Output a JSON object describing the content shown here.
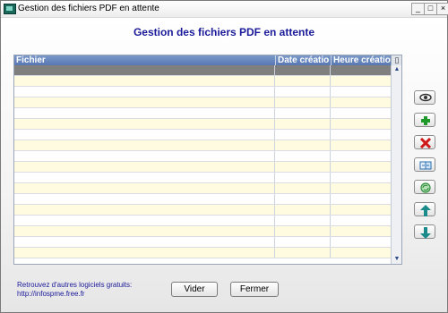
{
  "window": {
    "title": "Gestion des fichiers PDF en attente",
    "controls": [
      "_",
      "□",
      "×"
    ]
  },
  "heading": "Gestion des fichiers PDF en attente",
  "table": {
    "columns": [
      "Fichier",
      "Date création",
      "Heure création"
    ],
    "rows": 18,
    "selected_row": 0
  },
  "side_buttons": [
    {
      "name": "view-icon",
      "color": "#333333"
    },
    {
      "name": "add-icon",
      "color": "#1f9a2a"
    },
    {
      "name": "delete-icon",
      "color": "#d01818"
    },
    {
      "name": "convert-icon",
      "color": "#2a6fb0"
    },
    {
      "name": "recycle-icon",
      "color": "#2f8f3a"
    },
    {
      "name": "arrow-up-icon",
      "color": "#1a8a8a"
    },
    {
      "name": "arrow-down-icon",
      "color": "#1a8a8a"
    }
  ],
  "footer": {
    "line1": "Retrouvez d'autres logiciels gratuits:",
    "line2": "http://infospme.free.fr"
  },
  "buttons": {
    "vider": "Vider",
    "fermer": "Fermer"
  },
  "colors": {
    "header_bg": "#5877b3",
    "selected_row": "#7f7f7f",
    "alt_row": "#fffbe0",
    "title_color": "#1a1a9a"
  }
}
